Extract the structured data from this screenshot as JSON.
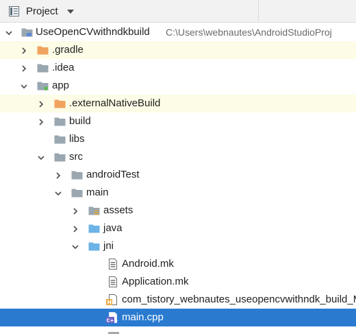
{
  "panel": {
    "title": "Project"
  },
  "tree": {
    "rows": [
      {
        "label": "UseOpenCVwithndkbuild",
        "path": "C:\\Users\\webnautes\\AndroidStudioProj",
        "icon": "module-folder-icon",
        "expanded": true
      },
      {
        "label": ".gradle",
        "icon": "orange-folder-icon",
        "expanded": false
      },
      {
        "label": ".idea",
        "icon": "gray-folder-icon",
        "expanded": false
      },
      {
        "label": "app",
        "icon": "module-folder-icon",
        "expanded": true
      },
      {
        "label": ".externalNativeBuild",
        "icon": "orange-folder-icon",
        "expanded": false
      },
      {
        "label": "build",
        "icon": "gray-folder-icon",
        "expanded": false
      },
      {
        "label": "libs",
        "icon": "gray-folder-icon"
      },
      {
        "label": "src",
        "icon": "gray-folder-icon",
        "expanded": true
      },
      {
        "label": "androidTest",
        "icon": "gray-folder-icon",
        "expanded": false
      },
      {
        "label": "main",
        "icon": "gray-folder-icon",
        "expanded": true
      },
      {
        "label": "assets",
        "icon": "assets-folder-icon",
        "expanded": false
      },
      {
        "label": "java",
        "icon": "blue-folder-icon",
        "expanded": false
      },
      {
        "label": "jni",
        "icon": "blue-folder-icon",
        "expanded": true
      },
      {
        "label": "Android.mk",
        "icon": "text-file-icon"
      },
      {
        "label": "Application.mk",
        "icon": "text-file-icon"
      },
      {
        "label": "com_tistory_webnautes_useopencvwithndk_build_M",
        "icon": "header-file-icon"
      },
      {
        "label": "main.cpp",
        "icon": "cpp-file-icon",
        "selected": true
      }
    ]
  },
  "colors": {
    "selection": "#2a7bd0",
    "highlight_row": "#fdfce6",
    "orange_folder": "#f0a35e",
    "gray_folder": "#9aa7b0",
    "blue_folder": "#6cb4e6"
  }
}
